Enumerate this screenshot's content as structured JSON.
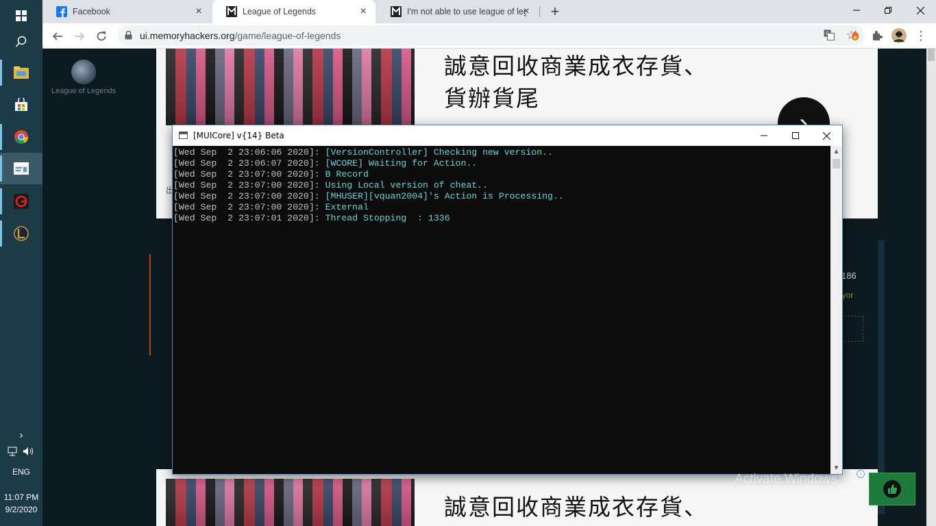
{
  "taskbar": {
    "apps": [
      {
        "name": "start",
        "icon": "windows-start-icon"
      },
      {
        "name": "search",
        "icon": "search-icon"
      },
      {
        "name": "file-explorer",
        "icon": "folder-icon"
      },
      {
        "name": "microsoft-store",
        "icon": "store-icon"
      },
      {
        "name": "chrome",
        "icon": "chrome-icon"
      },
      {
        "name": "console-app",
        "icon": "console-window-icon"
      },
      {
        "name": "garena",
        "icon": "garena-icon"
      },
      {
        "name": "league-client",
        "icon": "league-icon"
      }
    ],
    "language": "ENG",
    "time": "11:07 PM",
    "date": "9/2/2020"
  },
  "browser": {
    "tabs": [
      {
        "title": "Facebook",
        "icon": "facebook-icon"
      },
      {
        "title": "League of Legends",
        "icon": "memoryhackers-icon"
      },
      {
        "title": "I'm not able to use league of leg",
        "icon": "memoryhackers-icon"
      }
    ],
    "url_host": "ui.memoryhackers.org",
    "url_path": "/game/league-of-legends"
  },
  "page": {
    "game_label": "League of Legends",
    "ad_headline_line1": "誠意回收商業成衣存貨、",
    "ad_headline_line2": "貨辦貨尾",
    "partial_number": "186",
    "partial_green": "uyor",
    "partial_left_char": "出"
  },
  "console": {
    "title": "[MUICore] v{14} Beta",
    "lines": [
      {
        "ts": "[Wed Sep  2 23:06:06 2020]: ",
        "msg": "[VersionController] Checking new version.."
      },
      {
        "ts": "[Wed Sep  2 23:06:07 2020]: ",
        "msg": "[WCORE] Waiting for Action.."
      },
      {
        "ts": "[Wed Sep  2 23:07:00 2020]: ",
        "msg": "B Record"
      },
      {
        "ts": "[Wed Sep  2 23:07:00 2020]: ",
        "msg": "Using Local version of cheat.."
      },
      {
        "ts": "[Wed Sep  2 23:07:00 2020]: ",
        "msg": "[MHUSER][vquan2004]'s Action is Processing.."
      },
      {
        "ts": "[Wed Sep  2 23:07:00 2020]: ",
        "msg": "External"
      },
      {
        "ts": "[Wed Sep  2 23:07:01 2020]: ",
        "msg": "Thread Stopping  : 1336"
      }
    ]
  },
  "watermark": {
    "line1": "Activate Windows",
    "line2": "Go to Settings to activate Windows."
  },
  "colors": {
    "console_bg": "#0c0c0c",
    "console_timestamp": "#c0c0c0",
    "console_message": "#61d6d6",
    "taskbar_bg": "#1d3a47",
    "page_bg": "#0d1a20"
  }
}
